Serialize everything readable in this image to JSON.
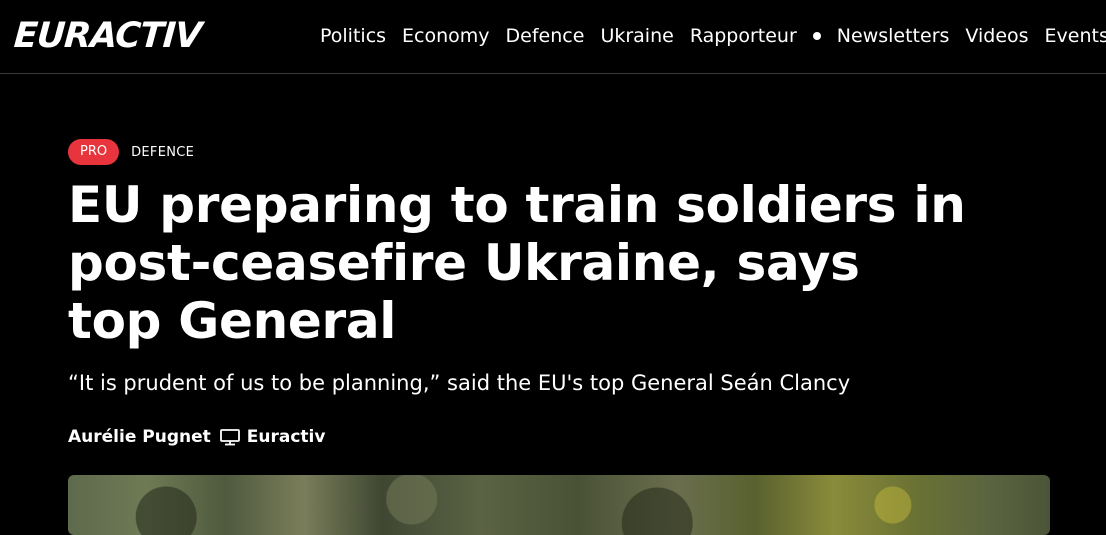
{
  "header": {
    "logo": "EURACTIV",
    "nav": [
      "Politics",
      "Economy",
      "Defence",
      "Ukraine",
      "Rapporteur"
    ],
    "nav_secondary": [
      "Newsletters",
      "Videos",
      "Events"
    ]
  },
  "article": {
    "badge": "PRO",
    "section": "DEFENCE",
    "headline": "EU preparing to train soldiers in post-ceasefire Ukraine, says top General",
    "subtitle": "“It is prudent of us to be planning,” said the EU's top General Seán Clancy",
    "author": "Aurélie Pugnet",
    "source_icon": "monitor-icon",
    "source": "Euractiv"
  },
  "colors": {
    "background": "#000000",
    "badge": "#e8343c",
    "text": "#ffffff"
  }
}
